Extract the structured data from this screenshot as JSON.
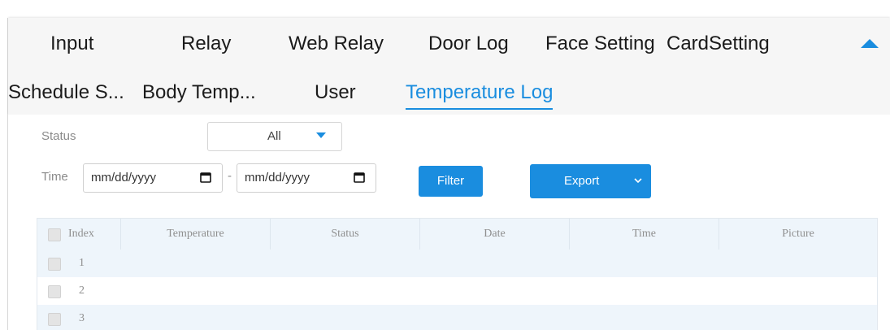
{
  "tabs": {
    "row1": [
      "Input",
      "Relay",
      "Web Relay",
      "Door Log",
      "Face Setting",
      "CardSetting"
    ],
    "row2": [
      "Schedule S...",
      "Body Temp...",
      "User",
      "Temperature Log"
    ],
    "active": "Temperature Log",
    "collapse_icon": "caret-up-icon"
  },
  "filters": {
    "status_label": "Status",
    "status_value": "All",
    "time_label": "Time",
    "date_from_placeholder": "mm/dd/yyyy",
    "date_to_placeholder": "mm/dd/yyyy",
    "range_separator": "-",
    "filter_button": "Filter",
    "export_button": "Export"
  },
  "table": {
    "columns": [
      "Index",
      "Temperature",
      "Status",
      "Date",
      "Time",
      "Picture"
    ],
    "rows": [
      "1",
      "2",
      "3"
    ]
  },
  "colors": {
    "accent": "#1a8ddf",
    "tab_panel_bg": "#f6f6f6",
    "table_header_bg": "#eef5fb"
  }
}
